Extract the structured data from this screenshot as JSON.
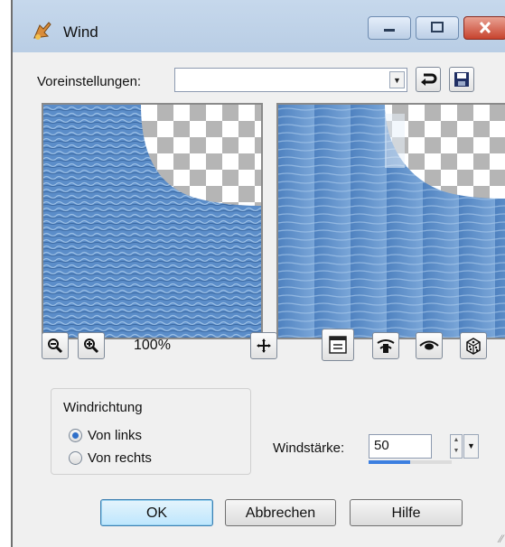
{
  "window": {
    "title": "Wind"
  },
  "titlebar_buttons": {
    "minimize_icon": "minimize-icon",
    "maximize_icon": "maximize-icon",
    "close_icon": "close-icon"
  },
  "presets": {
    "label": "Voreinstellungen:",
    "value": "",
    "reset_icon": "reset-icon",
    "save_icon": "save-icon"
  },
  "preview": {
    "zoom": "100%",
    "zoom_out_icon": "zoom-out-icon",
    "zoom_in_icon": "zoom-in-icon",
    "pan_icon": "pan-icon"
  },
  "toolbar_icons": [
    "list-icon",
    "proof-icon",
    "eye-icon",
    "dice-icon"
  ],
  "direction": {
    "label": "Windrichtung",
    "options": [
      {
        "label": "Von links",
        "selected": true
      },
      {
        "label": "Von rechts",
        "selected": false
      }
    ]
  },
  "strength": {
    "label": "Windstärke:",
    "value": "50",
    "percent": 50
  },
  "buttons": {
    "ok": "OK",
    "cancel": "Abbrechen",
    "help": "Hilfe"
  },
  "colors": {
    "accent": "#3c7fe0",
    "water": "#5b8dc9"
  }
}
